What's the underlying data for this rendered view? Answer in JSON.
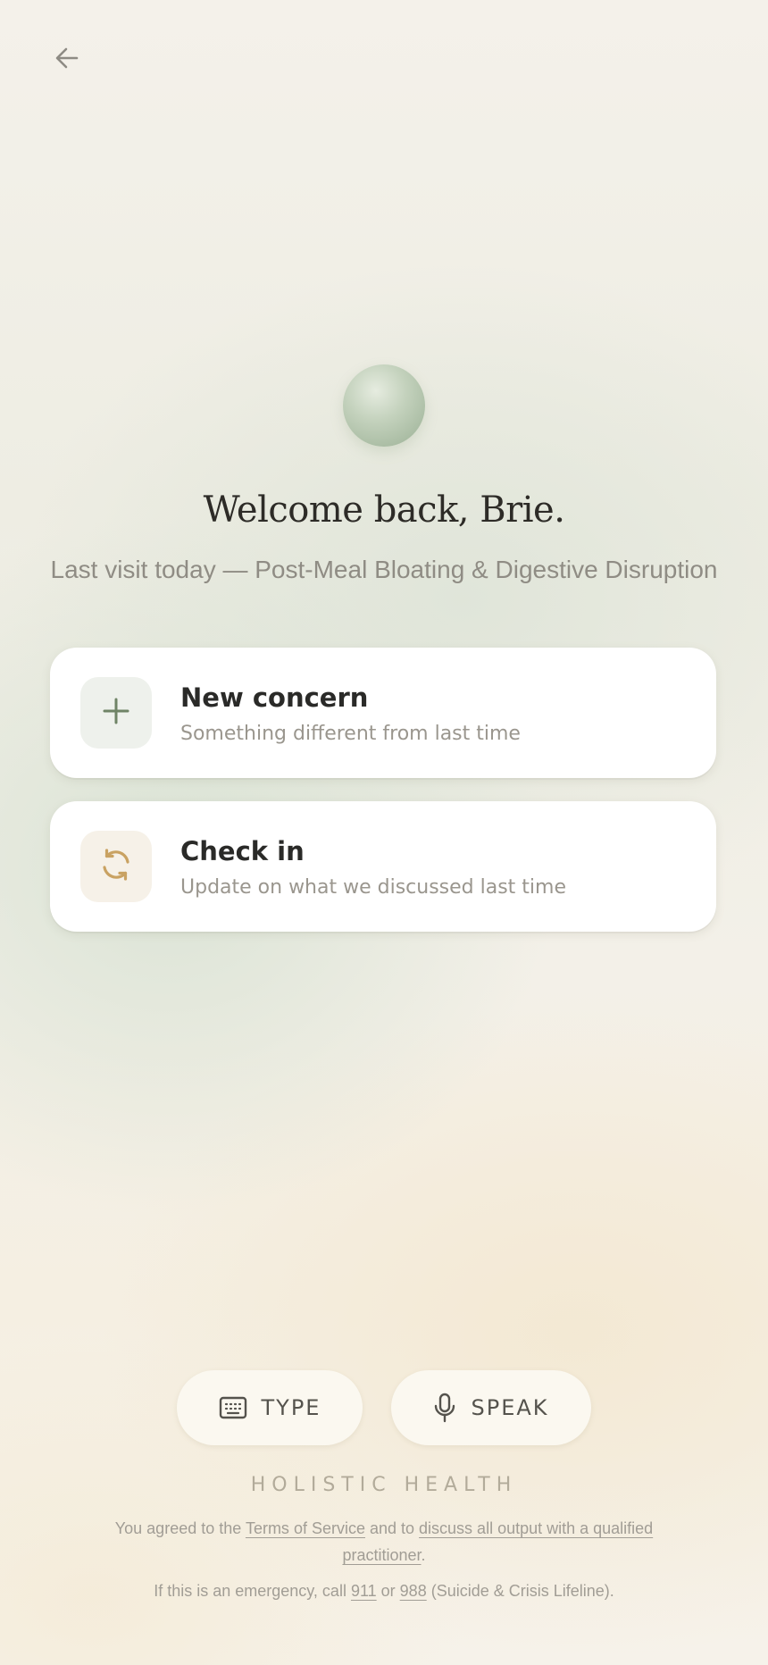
{
  "header": {
    "back_icon": "arrow-left-icon"
  },
  "hero": {
    "title": "Welcome back, Brie.",
    "subtitle": "Last visit today — Post-Meal Bloating & Digestive Disruption"
  },
  "options": [
    {
      "icon": "plus-icon",
      "title": "New concern",
      "subtitle": "Something different from last time"
    },
    {
      "icon": "refresh-icon",
      "title": "Check in",
      "subtitle": "Update on what we discussed last time"
    }
  ],
  "input_modes": {
    "type_label": "TYPE",
    "type_icon": "keyboard-icon",
    "speak_label": "SPEAK",
    "speak_icon": "microphone-icon"
  },
  "footer": {
    "brand": "HOLISTIC HEALTH",
    "agree_prefix": "You agreed to the ",
    "terms_link": "Terms of Service",
    "agree_middle": " and to ",
    "discuss_link": "discuss all output with a qualified practitioner",
    "agree_suffix": ".",
    "emergency_prefix": "If this is an emergency, call ",
    "emergency_911": "911",
    "emergency_or": " or ",
    "emergency_988": "988",
    "emergency_suffix": " (Suicide & Crisis Lifeline)."
  },
  "colors": {
    "accent_green": "#6f8466",
    "accent_gold": "#c9a262",
    "text_dark": "#2a2a28",
    "text_muted": "#9a968e"
  }
}
